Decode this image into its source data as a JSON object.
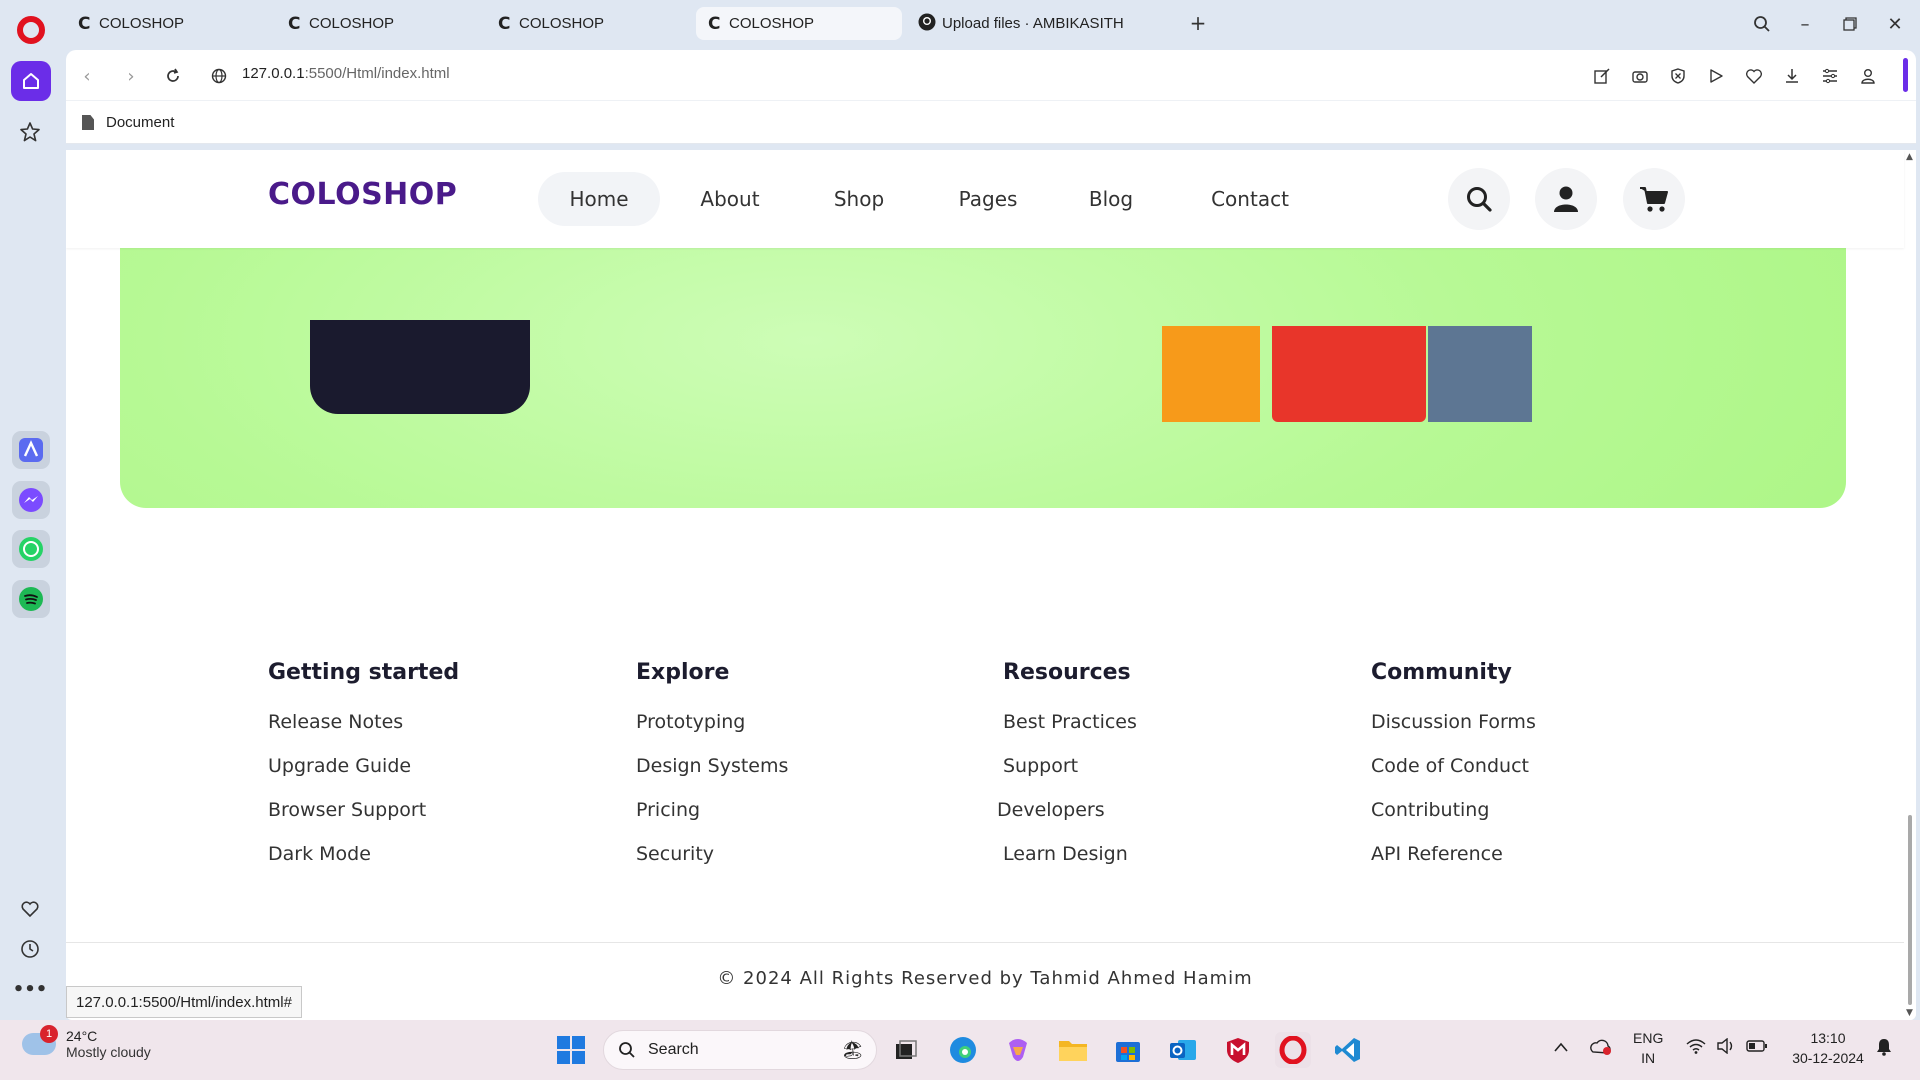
{
  "browser": {
    "tabs": [
      {
        "favicon": "C",
        "title": "COLOSHOP",
        "active": false
      },
      {
        "favicon": "C",
        "title": "COLOSHOP",
        "active": false
      },
      {
        "favicon": "C",
        "title": "COLOSHOP",
        "active": false
      },
      {
        "favicon": "C",
        "title": "COLOSHOP",
        "active": true
      },
      {
        "favicon": "github-icon",
        "title": "Upload files · AMBIKASITH",
        "active": false
      }
    ],
    "url_host": "127.0.0.1",
    "url_rest": ":5500/Html/index.html",
    "bookmark": "Document",
    "status_url": "127.0.0.1:5500/Html/index.html#",
    "accent": "#6b2de8"
  },
  "site": {
    "brand": "COLOSHOP",
    "brand_color": "#4a1a8a",
    "nav": [
      "Home",
      "About",
      "Shop",
      "Pages",
      "Blog",
      "Contact"
    ],
    "hero_color": "#b7f995",
    "footer": {
      "columns": [
        {
          "title": "Getting started",
          "links": [
            "Release Notes",
            "Upgrade Guide",
            "Browser Support",
            "Dark Mode"
          ]
        },
        {
          "title": "Explore",
          "links": [
            "Prototyping",
            "Design Systems",
            "Pricing",
            "Security"
          ]
        },
        {
          "title": "Resources",
          "links": [
            "Best Practices",
            "Support",
            "Developers",
            "Learn Design"
          ]
        },
        {
          "title": "Community",
          "links": [
            "Discussion Forms",
            "Code of Conduct",
            "Contributing",
            "API Reference"
          ]
        }
      ],
      "copyright": "© 2024 All Rights Reserved by Tahmid Ahmed Hamim"
    }
  },
  "taskbar": {
    "weather_temp": "24°C",
    "weather_desc": "Mostly cloudy",
    "weather_badge": "1",
    "search_placeholder": "Search",
    "lang_1": "ENG",
    "lang_2": "IN",
    "time": "13:10",
    "date": "30-12-2024"
  }
}
